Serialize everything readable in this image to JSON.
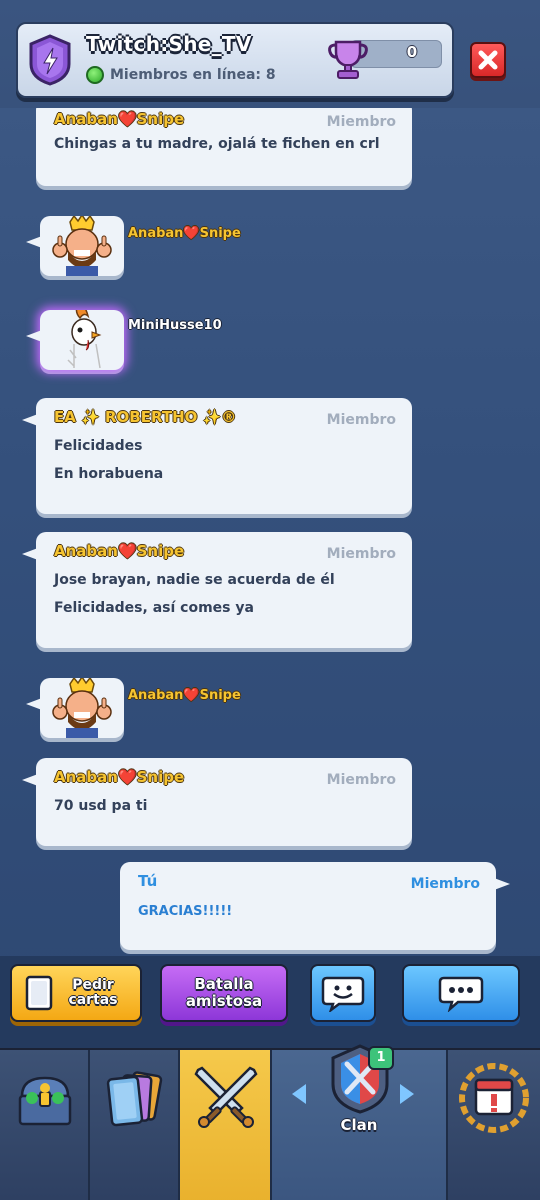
{
  "header": {
    "clan_name": "Twitch:She_TV",
    "online_label": "Miembros en línea: 8",
    "trophies": "0"
  },
  "chat": {
    "messages": [
      {
        "sender": "Anaban❤️Snipe",
        "role": "Miembro",
        "lines": [
          "Chingas a tu madre, ojalá te fichen en crl"
        ]
      },
      {
        "type": "emote",
        "sender": "Anaban❤️Snipe",
        "emote": "king-thumbs-up"
      },
      {
        "type": "emote",
        "sender": "MiniHusse10",
        "emote": "chicken"
      },
      {
        "sender": "EA ✨ ROBERTHO ✨®",
        "role": "Miembro",
        "lines": [
          "Felicidades",
          "En horabuena"
        ]
      },
      {
        "sender": "Anaban❤️Snipe",
        "role": "Miembro",
        "lines": [
          "Jose brayan, nadie se acuerda de él",
          "Felicidades, así comes ya"
        ]
      },
      {
        "type": "emote",
        "sender": "Anaban❤️Snipe",
        "emote": "king-thumbs-up"
      },
      {
        "sender": "Anaban❤️Snipe",
        "role": "Miembro",
        "lines": [
          "70 usd pa ti"
        ]
      },
      {
        "sender": "Tú",
        "role": "Miembro",
        "lines": [
          "GRACIAS!!!!!"
        ],
        "own": true
      }
    ]
  },
  "actions": {
    "request_cards": "Pedir cartas",
    "friendly_battle": "Batalla amistosa",
    "emote": "emote",
    "chat": "chat"
  },
  "nav": {
    "tabs": [
      "shop",
      "cards",
      "battle",
      "clan",
      "events"
    ],
    "clan_label": "Clan",
    "clan_badge": "1"
  },
  "colors": {
    "background": "#34507c",
    "bubble": "#eef3f9",
    "sender_gold": "#f6c431",
    "own_blue": "#2f8fe0",
    "role_gray": "#a2adbd"
  }
}
